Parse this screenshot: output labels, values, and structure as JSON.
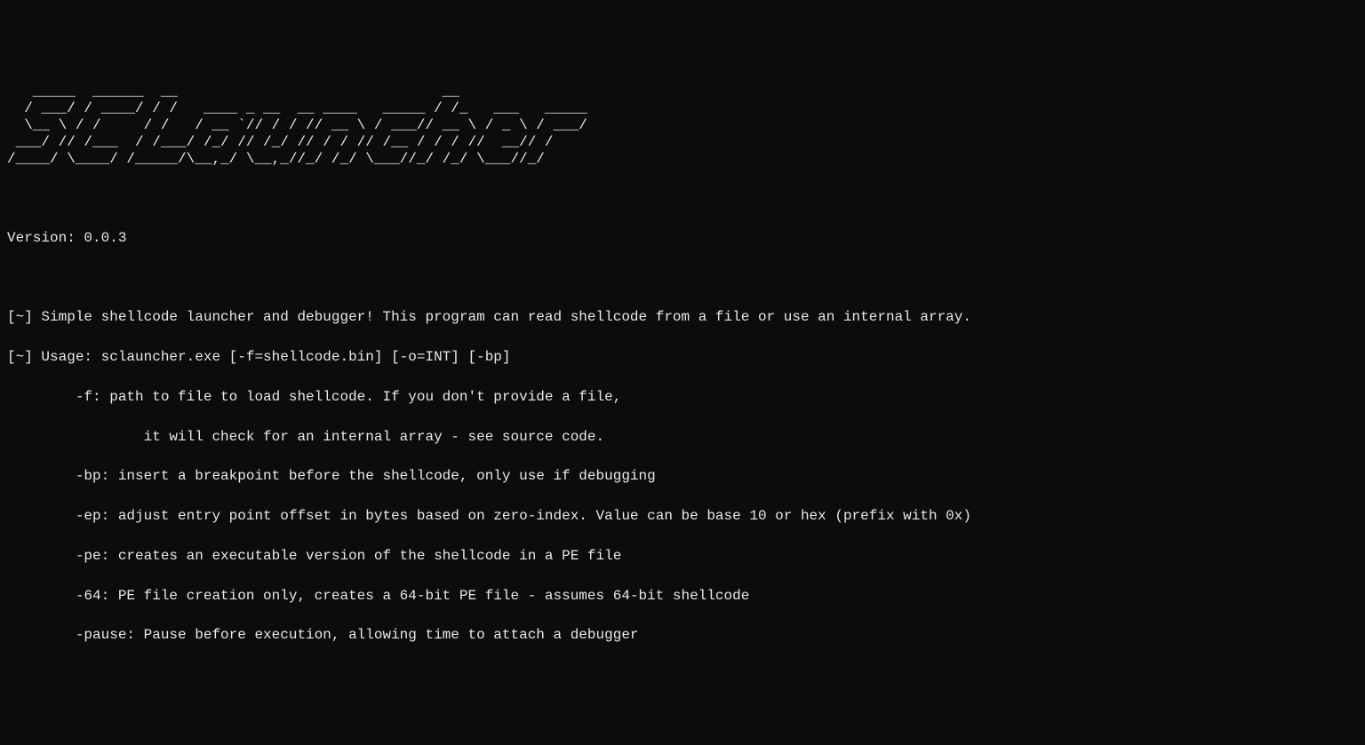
{
  "banner": "   _____  ______  __                               __             \n  / ___/ / ____/ / /   ____ _ __  __ ____   _____ / /_   ___   _____\n  \\__ \\ / /     / /   / __ `// / / // __ \\ / ___// __ \\ / _ \\ / ___/\n ___/ // /___  / /___/ /_/ // /_/ // / / // /__ / / / //  __// /    \n/____/ \\____/ /_____/\\__,_/ \\__,_//_/ /_/ \\___//_/ /_/ \\___//_/     ",
  "version_line": "Version: 0.0.3",
  "desc_line": "[~] Simple shellcode launcher and debugger! This program can read shellcode from a file or use an internal array.",
  "usage_line": "[~] Usage: sclauncher.exe [-f=shellcode.bin] [-o=INT] [-bp]",
  "opts": [
    "        -f: path to file to load shellcode. If you don't provide a file,",
    "                it will check for an internal array - see source code.",
    "        -bp: insert a breakpoint before the shellcode, only use if debugging",
    "        -ep: adjust entry point offset in bytes based on zero-index. Value can be base 10 or hex (prefix with 0x)",
    "        -pe: creates an executable version of the shellcode in a PE file",
    "        -64: PE file creation only, creates a 64-bit PE file - assumes 64-bit shellcode",
    "        -pause: Pause before execution, allowing time to attach a debugger"
  ]
}
